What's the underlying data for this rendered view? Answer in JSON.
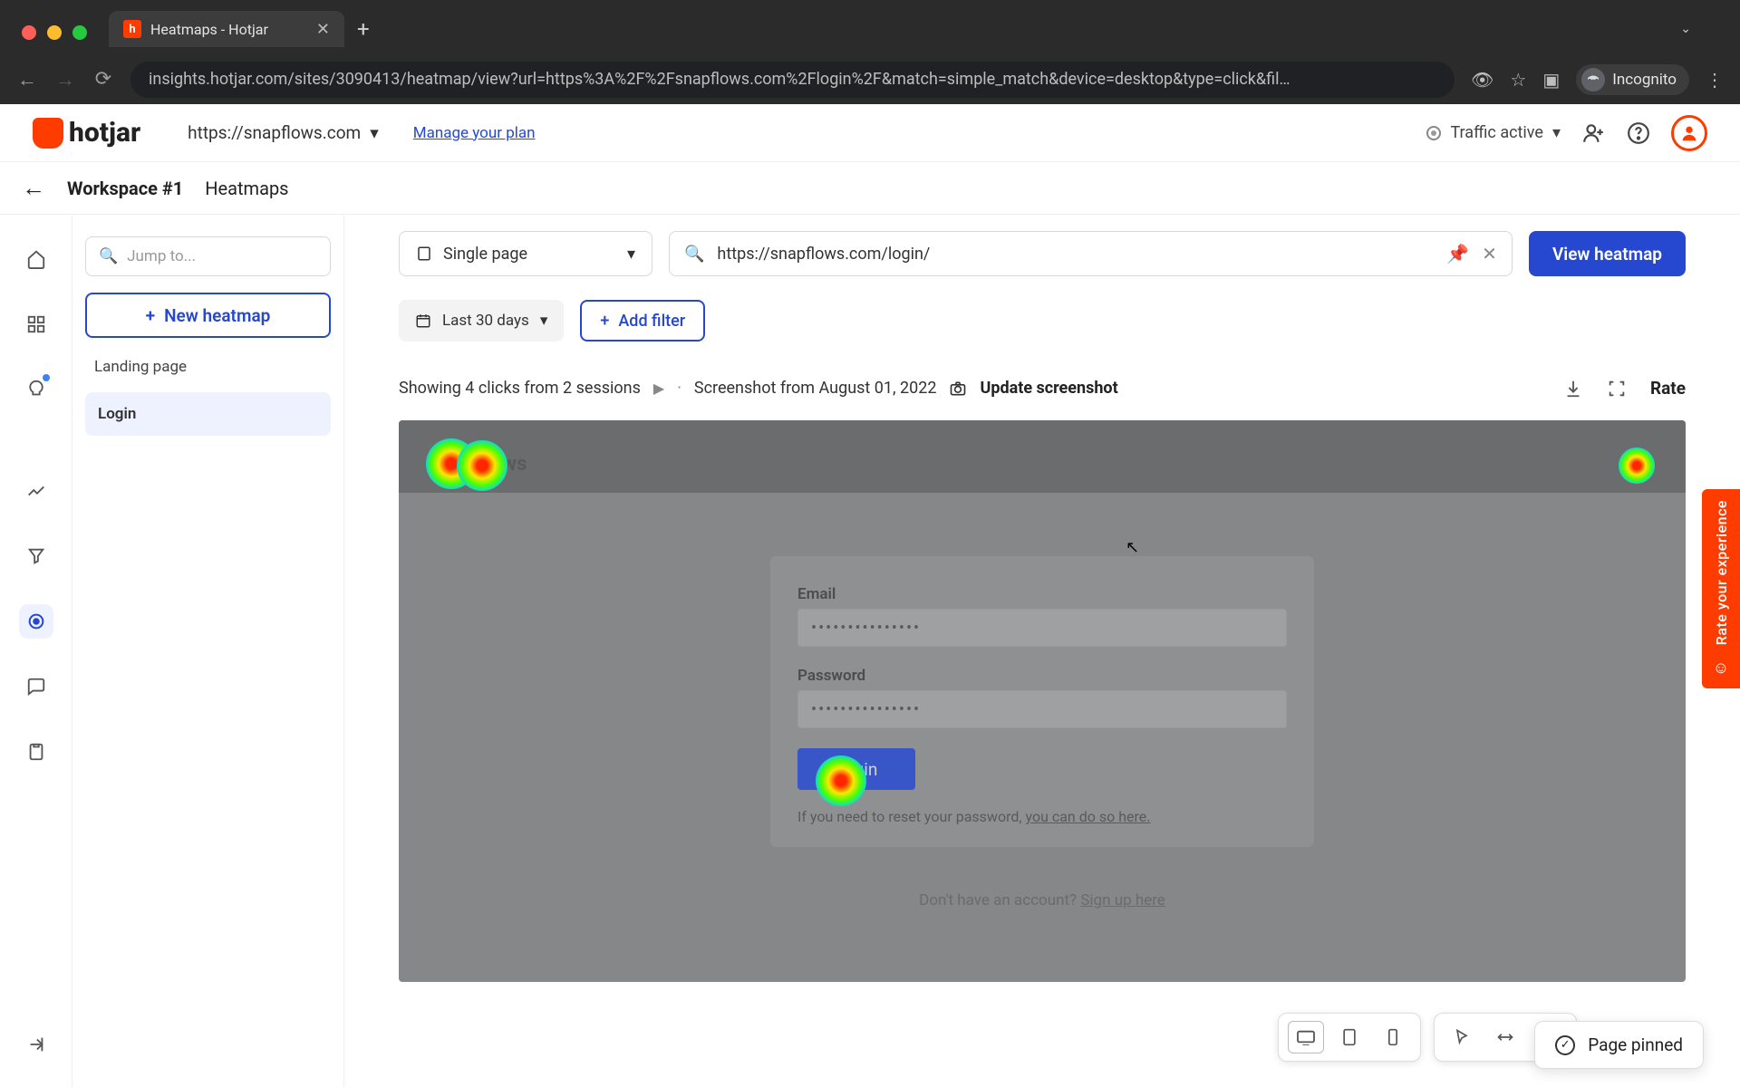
{
  "browser": {
    "tab_title": "Heatmaps - Hotjar",
    "url": "insights.hotjar.com/sites/3090413/heatmap/view?url=https%3A%2F%2Fsnapflows.com%2Flogin%2F&match=simple_match&device=desktop&type=click&fil…",
    "incognito_label": "Incognito"
  },
  "topbar": {
    "brand": "hotjar",
    "site_selector": "https://snapflows.com",
    "manage_plan": "Manage your plan",
    "traffic_label": "Traffic active"
  },
  "crumbs": {
    "workspace": "Workspace #1",
    "section": "Heatmaps"
  },
  "sidebar": {
    "jump_placeholder": "Jump to...",
    "new_heatmap": "New heatmap",
    "landing_label": "Landing page",
    "login_label": "Login"
  },
  "controls": {
    "scope_label": "Single page",
    "url_value": "https://snapflows.com/login/",
    "view_btn": "View heatmap",
    "date_label": "Last 30 days",
    "add_filter": "Add filter"
  },
  "info": {
    "showing": "Showing 4 clicks from 2 sessions",
    "screenshot": "Screenshot from August 01, 2022",
    "update": "Update screenshot",
    "rate": "Rate"
  },
  "preview": {
    "site_name": "Snapflows",
    "email_label": "Email",
    "dots": "•••••••••••••••",
    "password_label": "Password",
    "login_btn": "Login",
    "reset_prefix": "If you need to reset your password, ",
    "reset_link": "you can do so here.",
    "signup_prefix": "Don't have an account? ",
    "signup_link": "Sign up here"
  },
  "toast": {
    "text": "Page pinned"
  },
  "rate_tab": {
    "text": "Rate your experience"
  }
}
